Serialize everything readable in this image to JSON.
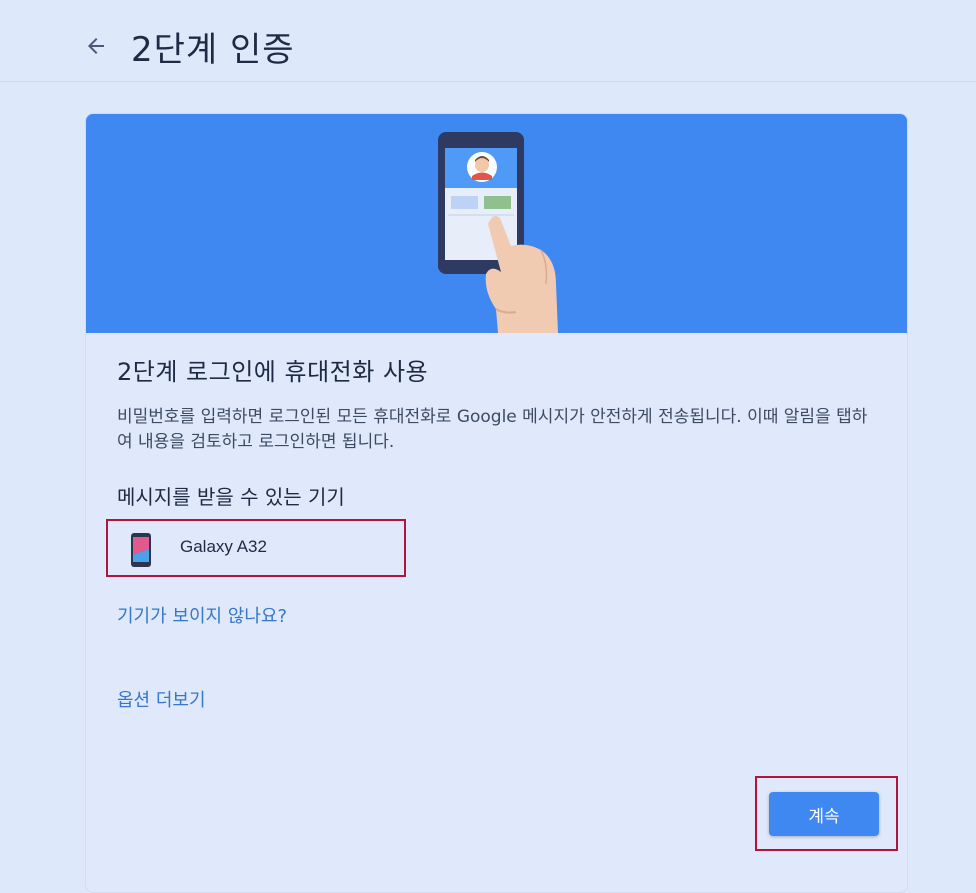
{
  "header": {
    "title": "2단계 인증",
    "back_icon": "arrow-back-icon"
  },
  "card": {
    "hero_icon": "phone-tap-illustration",
    "heading": "2단계 로그인에 휴대전화 사용",
    "description": "비밀번호를 입력하면 로그인된 모든 휴대전화로 Google 메시지가 안전하게 전송됩니다. 이때 알림을 탭하여 내용을 검토하고 로그인하면 됩니다.",
    "devices_heading": "메시지를 받을 수 있는 기기",
    "devices": [
      {
        "name": "Galaxy A32",
        "icon": "phone-icon"
      }
    ],
    "help_link": "기기가 보이지 않나요?",
    "more_options_link": "옵션 더보기",
    "continue_label": "계속"
  },
  "colors": {
    "background": "#dde8fb",
    "hero": "#3f88f2",
    "link": "#3677c8",
    "highlight": "#b0163a",
    "button": "#3f88f2"
  }
}
